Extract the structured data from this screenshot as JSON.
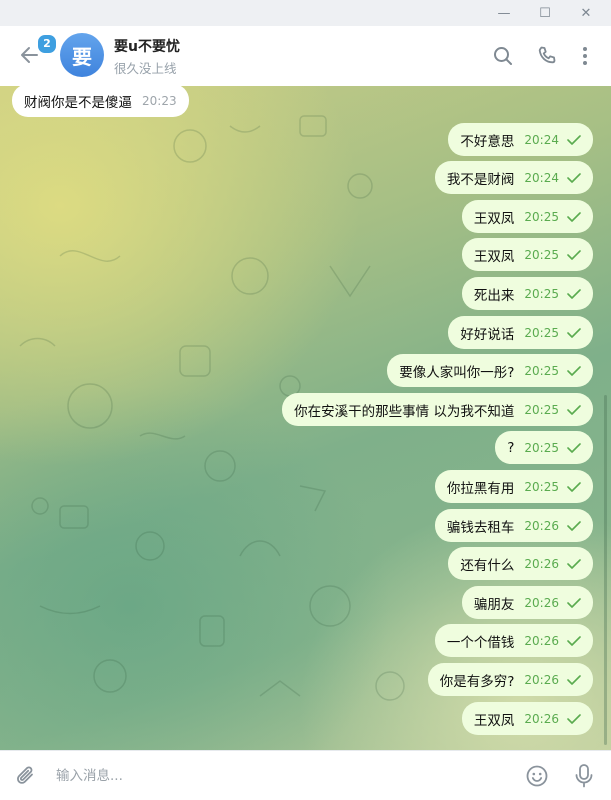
{
  "window": {
    "minimize_glyph": "—",
    "maximize_glyph": "☐",
    "close_glyph": "✕"
  },
  "header": {
    "back_icon": "arrow-left-icon",
    "unread_badge": "2",
    "avatar_letter": "要",
    "avatar_color": "#4a90e2",
    "chat_name": "要u不要忧",
    "status": "很久没上线",
    "icons": [
      "search-icon",
      "phone-icon",
      "more-vertical-icon"
    ]
  },
  "messages": [
    {
      "dir": "in",
      "text": "财阀你是不是傻逼",
      "time": "20:23"
    },
    {
      "dir": "out",
      "text": "不好意思",
      "time": "20:24",
      "read": true
    },
    {
      "dir": "out",
      "text": "我不是财阀",
      "time": "20:24",
      "read": true
    },
    {
      "dir": "out",
      "text": "王双凤",
      "time": "20:25",
      "read": true
    },
    {
      "dir": "out",
      "text": "王双凤",
      "time": "20:25",
      "read": true
    },
    {
      "dir": "out",
      "text": "死出来",
      "time": "20:25",
      "read": true
    },
    {
      "dir": "out",
      "text": "好好说话",
      "time": "20:25",
      "read": true
    },
    {
      "dir": "out",
      "text": "要像人家叫你一彤?",
      "time": "20:25",
      "read": true
    },
    {
      "dir": "out",
      "text": "你在安溪干的那些事情 以为我不知道",
      "time": "20:25",
      "read": true
    },
    {
      "dir": "out",
      "text": "?",
      "time": "20:25",
      "read": true
    },
    {
      "dir": "out",
      "text": "你拉黑有用",
      "time": "20:25",
      "read": true
    },
    {
      "dir": "out",
      "text": "骗钱去租车",
      "time": "20:26",
      "read": true
    },
    {
      "dir": "out",
      "text": "还有什么",
      "time": "20:26",
      "read": true
    },
    {
      "dir": "out",
      "text": "骗朋友",
      "time": "20:26",
      "read": true
    },
    {
      "dir": "out",
      "text": "一个个借钱",
      "time": "20:26",
      "read": true
    },
    {
      "dir": "out",
      "text": "你是有多穷?",
      "time": "20:26",
      "read": true
    },
    {
      "dir": "out",
      "text": "王双凤",
      "time": "20:26",
      "read": true
    }
  ],
  "composer": {
    "placeholder": "输入消息...",
    "value": "",
    "icons": [
      "paperclip-icon",
      "emoji-icon",
      "microphone-icon"
    ]
  },
  "colors": {
    "accent": "#3e9fe0",
    "outgoing_bubble": "#effdde",
    "incoming_bubble": "#ffffff",
    "read_check": "#5aab4f"
  }
}
